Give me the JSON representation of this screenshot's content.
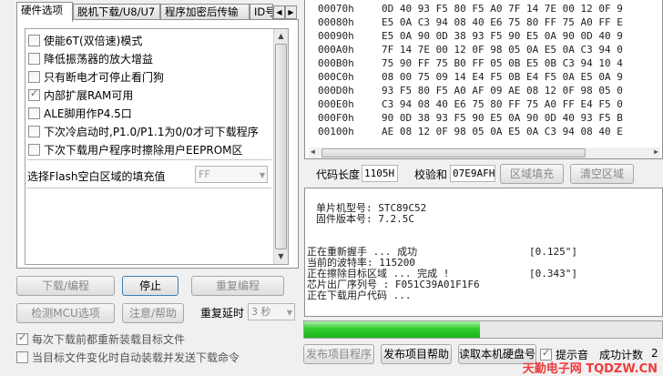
{
  "tabs": [
    {
      "label": "硬件选项",
      "active": true
    },
    {
      "label": "脱机下载/U8/U7",
      "active": false
    },
    {
      "label": "程序加密后传输",
      "active": false
    },
    {
      "label": "ID号",
      "active": false
    }
  ],
  "options": [
    {
      "label": "使能6T(双倍速)模式",
      "checked": false
    },
    {
      "label": "降低振荡器的放大增益",
      "checked": false
    },
    {
      "label": "只有断电才可停止看门狗",
      "checked": false
    },
    {
      "label": "内部扩展RAM可用",
      "checked": true
    },
    {
      "label": "ALE脚用作P4.5口",
      "checked": false
    },
    {
      "label": "下次冷启动时,P1.0/P1.1为0/0才可下载程序",
      "checked": false
    },
    {
      "label": "下次下载用户程序时擦除用户EEPROM区",
      "checked": false
    }
  ],
  "fill_select": {
    "label": "选择Flash空白区域的填充值",
    "value": "FF"
  },
  "hex_rows": [
    {
      "addr": "00070h",
      "bytes": "0D 40 93 F5 80 F5 A0 7F 14 7E 00 12 0F 9"
    },
    {
      "addr": "00080h",
      "bytes": "E5 0A C3 94 08 40 E6 75 80 FF 75 A0 FF E"
    },
    {
      "addr": "00090h",
      "bytes": "E5 0A 90 0D 38 93 F5 90 E5 0A 90 0D 40 9"
    },
    {
      "addr": "000A0h",
      "bytes": "7F 14 7E 00 12 0F 98 05 0A E5 0A C3 94 0"
    },
    {
      "addr": "000B0h",
      "bytes": "75 90 FF 75 B0 FF 05 0B E5 0B C3 94 10 4"
    },
    {
      "addr": "000C0h",
      "bytes": "08 00 75 09 14 E4 F5 0B E4 F5 0A E5 0A 9"
    },
    {
      "addr": "000D0h",
      "bytes": "93 F5 80 F5 A0 AF 09 AE 08 12 0F 98 05 0"
    },
    {
      "addr": "000E0h",
      "bytes": "C3 94 08 40 E6 75 80 FF 75 A0 FF E4 F5 0"
    },
    {
      "addr": "000F0h",
      "bytes": "90 0D 38 93 F5 90 E5 0A 90 0D 40 93 F5 B"
    },
    {
      "addr": "00100h",
      "bytes": "AE 08 12 0F 98 05 0A E5 0A C3 94 08 40 E"
    }
  ],
  "code_info": {
    "length_label": "代码长度",
    "length_value": "1105H",
    "checksum_label": "校验和",
    "checksum_value": "07E9AFH",
    "fill_button": "区域填充",
    "clear_button": "清空区域"
  },
  "log": [
    {
      "text": "单片机型号: STC89C52",
      "value": ""
    },
    {
      "text": "固件版本号: 7.2.5C",
      "value": ""
    },
    {
      "text": "",
      "value": ""
    },
    {
      "text": "正在重新握手 ... 成功",
      "value": "[0.125\"]"
    },
    {
      "text": "当前的波特率: 115200",
      "value": ""
    },
    {
      "text": "正在擦除目标区域 ... 完成 !",
      "value": "[0.343\"]"
    },
    {
      "text": "芯片出厂序列号 : F051C39A01F1F6",
      "value": ""
    },
    {
      "text": "正在下载用户代码 ...",
      "value": ""
    }
  ],
  "progress": {
    "fraction": 0.49
  },
  "buttons": {
    "download": "下载/编程",
    "stop": "停止",
    "redo": "重复编程",
    "check_mcu": "检测MCU选项",
    "help": "注意/帮助",
    "repeat_delay_label": "重复延时",
    "repeat_delay_value": "3 秒",
    "publish_project": "发布项目程序",
    "publish_help": "发布项目帮助",
    "read_disk": "读取本机硬盘号"
  },
  "bottom_checks": [
    {
      "label": "每次下载前都重新装载目标文件",
      "checked": true
    },
    {
      "label": "当目标文件变化时自动装载并发送下载命令",
      "checked": false
    }
  ],
  "tone": {
    "label": "提示音",
    "checked": true
  },
  "success_count": {
    "label": "成功计数",
    "value": "2"
  },
  "watermark": "天勤电子网 TQDZW.CN",
  "colors": {
    "progress": "#2fce2f",
    "watermark": "#f03b3b"
  }
}
